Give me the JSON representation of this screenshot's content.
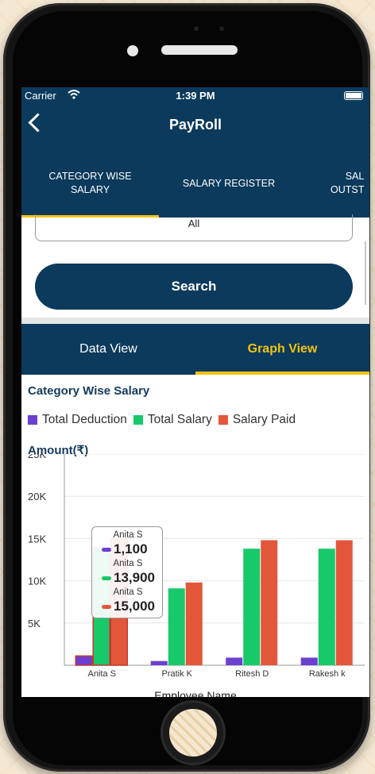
{
  "status": {
    "carrier": "Carrier",
    "time": "1:39 PM"
  },
  "nav": {
    "title": "PayRoll"
  },
  "tabs": [
    {
      "label": "CATEGORY WISE\nSALARY"
    },
    {
      "label": "SALARY REGISTER"
    },
    {
      "label": "SAL\nOUTST"
    }
  ],
  "filter": {
    "selected": "All",
    "search_label": "Search"
  },
  "view_tabs": {
    "data": "Data View",
    "graph": "Graph View"
  },
  "chart_data": {
    "type": "bar",
    "title": "Category Wise Salary",
    "ylabel": "Amount(₹)",
    "xlabel": "Employee Name",
    "ylim": [
      0,
      25000
    ],
    "yticks": [
      "5K",
      "10K",
      "15K",
      "20K",
      "25K"
    ],
    "ytick_values": [
      5000,
      10000,
      15000,
      20000,
      25000
    ],
    "categories": [
      "Anita S",
      "Pratik K",
      "Ritesh D",
      "Rakesh k"
    ],
    "series": [
      {
        "name": "Total Deduction",
        "color": "#6c3fd1",
        "values": [
          1100,
          500,
          900,
          900
        ]
      },
      {
        "name": "Total Salary",
        "color": "#18c96a",
        "values": [
          13900,
          9100,
          13800,
          13800
        ]
      },
      {
        "name": "Salary Paid",
        "color": "#e2573a",
        "values": [
          15000,
          9800,
          14800,
          14800
        ]
      }
    ],
    "legend_position": "top-left",
    "selected_category": "Anita S"
  },
  "tooltip": {
    "items": [
      {
        "name": "Anita S",
        "value": "1,100",
        "color": "#6c3fd1"
      },
      {
        "name": "Anita S",
        "value": "13,900",
        "color": "#18c96a"
      },
      {
        "name": "Anita S",
        "value": "15,000",
        "color": "#e2573a"
      }
    ]
  }
}
